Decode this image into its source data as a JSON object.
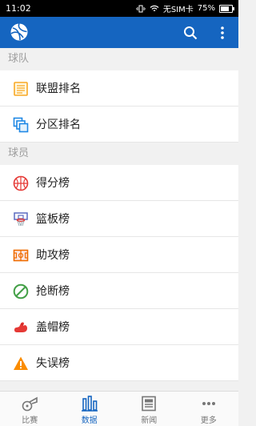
{
  "status_bar": {
    "time": "11:02",
    "carrier": "无SIM卡",
    "battery": "75%",
    "battery_level": 0.75
  },
  "app_bar": {
    "icons": [
      "basketball-logo-icon",
      "search-icon",
      "more-vert-icon"
    ]
  },
  "sections": [
    {
      "title": "球队",
      "items": [
        {
          "label": "联盟排名",
          "icon": "list-icon"
        },
        {
          "label": "分区排名",
          "icon": "layers-icon"
        }
      ]
    },
    {
      "title": "球员",
      "items": [
        {
          "label": "得分榜",
          "icon": "basketball-icon"
        },
        {
          "label": "篮板榜",
          "icon": "hoop-icon"
        },
        {
          "label": "助攻榜",
          "icon": "court-icon"
        },
        {
          "label": "抢断榜",
          "icon": "no-entry-icon"
        },
        {
          "label": "盖帽榜",
          "icon": "muscle-arm-icon"
        },
        {
          "label": "失误榜",
          "icon": "warning-icon"
        }
      ]
    }
  ],
  "colors": {
    "primary": "#1565c0",
    "statusbar": "#000000"
  },
  "bottom_nav": {
    "active": "数据",
    "tabs": [
      "比赛",
      "数据",
      "新闻",
      "更多"
    ]
  }
}
